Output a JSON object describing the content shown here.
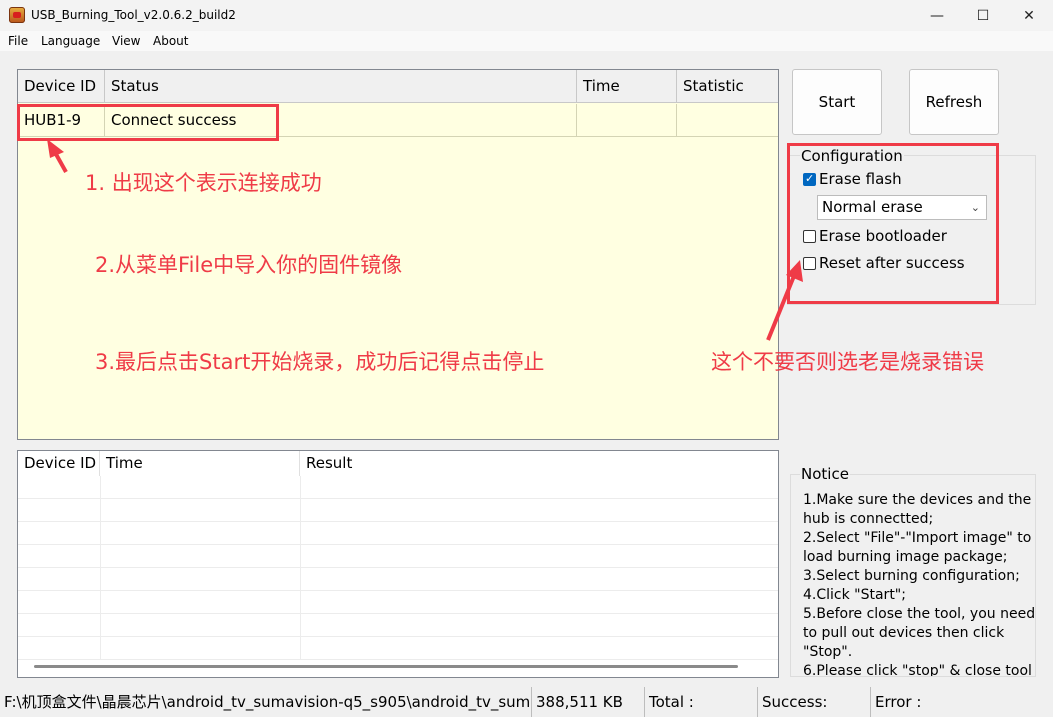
{
  "window": {
    "title": "USB_Burning_Tool_v2.0.6.2_build2",
    "minimize": "—",
    "maximize": "☐",
    "close": "✕"
  },
  "menu": [
    "File",
    "Language",
    "View",
    "About"
  ],
  "device_table": {
    "headers": [
      "Device ID",
      "Status",
      "Time",
      "Statistic"
    ],
    "rows": [
      {
        "device_id": "HUB1-9",
        "status": "Connect success",
        "time": "",
        "statistic": ""
      }
    ]
  },
  "buttons": {
    "start": "Start",
    "refresh": "Refresh"
  },
  "configuration": {
    "title": "Configuration",
    "erase_flash": {
      "label": "Erase flash",
      "checked": true
    },
    "erase_mode": "Normal erase",
    "erase_bootloader": {
      "label": "Erase bootloader",
      "checked": false
    },
    "reset_after_success": {
      "label": "Reset after success",
      "checked": false
    }
  },
  "annotations": {
    "note1": "1. 出现这个表示连接成功",
    "note2": "2.从菜单File中导入你的固件镜像",
    "note3": "3.最后点击Start开始烧录，成功后记得点击停止",
    "note4": "这个不要否则选老是烧录错误",
    "color": "#ef3b47"
  },
  "result_table": {
    "headers": [
      "Device ID",
      "Time",
      "Result"
    ]
  },
  "notice": {
    "title": "Notice",
    "text": "1.Make sure the devices and the hub is connectted;\n2.Select \"File\"-\"Import image\" to load burning image package;\n3.Select burning configuration;\n4.Click \"Start\";\n5.Before close the tool, you need to pull out devices then click \"Stop\".\n6.Please click \"stop\" & close tool"
  },
  "statusbar": {
    "path": "F:\\机顶盒文件\\晶晨芯片\\android_tv_sumavision-q5_s905\\android_tv_sum",
    "size": "388,511 KB",
    "total": "Total :",
    "success": "Success:",
    "error": "Error :"
  }
}
